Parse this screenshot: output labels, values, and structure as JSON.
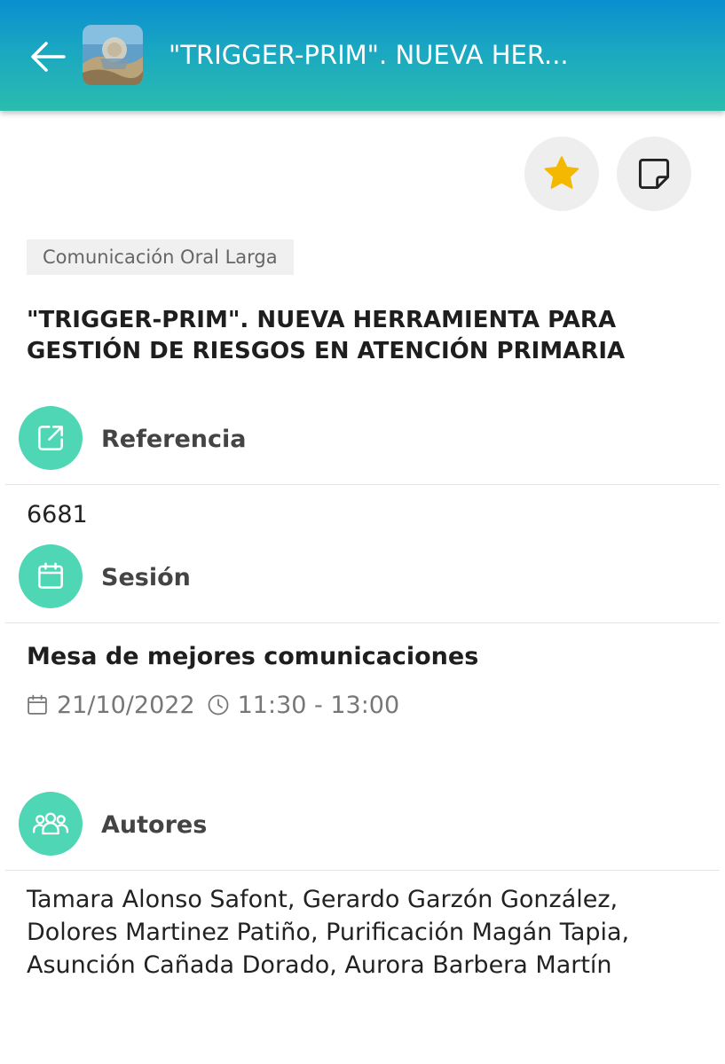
{
  "header": {
    "back_icon": "arrow-left-icon",
    "thumbnail_icon": "event-thumbnail",
    "title": "\"TRIGGER-PRIM\". NUEVA HER..."
  },
  "actions": {
    "favorite_icon": "star-icon",
    "favorite_color": "#f5b800",
    "note_icon": "sticky-note-icon"
  },
  "tag": "Comunicación Oral Larga",
  "title": "\"TRIGGER-PRIM\". NUEVA HERRAMIENTA PARA GESTIÓN DE RIESGOS EN ATENCIÓN PRIMARIA",
  "reference": {
    "icon": "external-link-icon",
    "label": "Referencia",
    "value": "6681"
  },
  "session": {
    "icon": "calendar-icon",
    "label": "Sesión",
    "name": "Mesa de mejores comunicaciones",
    "date": "21/10/2022",
    "time": "11:30 - 13:00"
  },
  "authors": {
    "icon": "users-icon",
    "label": "Autores",
    "value": "Tamara Alonso Safont, Gerardo Garzón González, Dolores Martinez Patiño, Purificación Magán Tapia, Asunción Cañada Dorado, Aurora Barbera Martín"
  },
  "colors": {
    "header_gradient_top": "#0a8ecf",
    "header_gradient_bottom": "#2bbcae",
    "section_icon_bg": "#4fd6b4"
  }
}
